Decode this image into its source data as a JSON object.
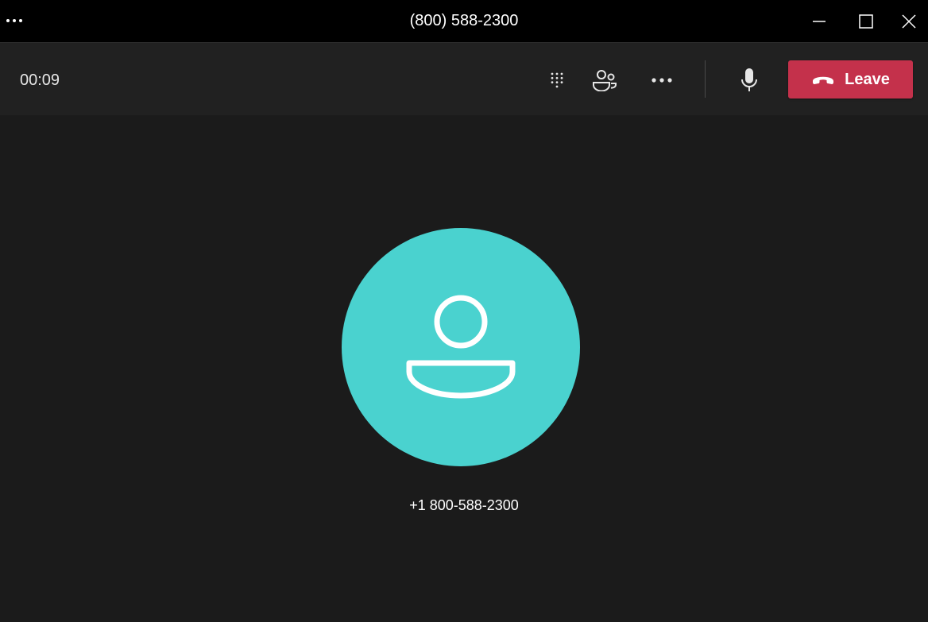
{
  "window": {
    "title": "(800) 588-2300",
    "more_icon": "more-horizontal-icon",
    "minimize_icon": "minimize-icon",
    "maximize_icon": "maximize-icon",
    "close_icon": "close-icon"
  },
  "controls": {
    "timer": "00:09",
    "dialpad_icon": "dialpad-icon",
    "people_icon": "people-icon",
    "more_icon": "more-horizontal-icon",
    "mic_icon": "microphone-icon",
    "leave_icon": "hang-up-phone-icon",
    "leave_label": "Leave"
  },
  "participant": {
    "name": "+1 800-588-2300",
    "avatar_icon": "person-icon",
    "avatar_color": "#4ad2cf"
  },
  "colors": {
    "titlebar_bg": "#000000",
    "controls_bg": "#212121",
    "stage_bg": "#1b1b1b",
    "leave_button": "#c4314b"
  }
}
